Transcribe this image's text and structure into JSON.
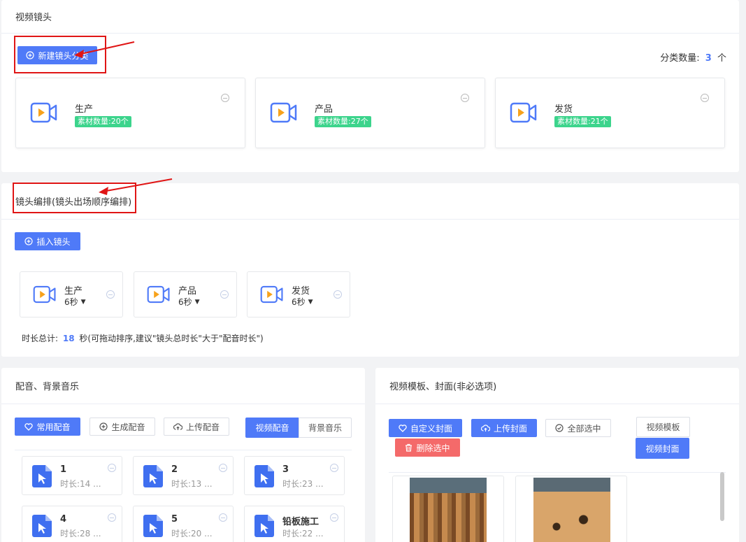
{
  "video_shots": {
    "title": "视频镜头",
    "new_category_button": "新建镜头分类",
    "category_count_label": "分类数量:",
    "category_count_value": "3",
    "category_count_unit": "个",
    "categories": [
      {
        "name": "生产",
        "badge": "素材数量:20个"
      },
      {
        "name": "产品",
        "badge": "素材数量:27个"
      },
      {
        "name": "发货",
        "badge": "素材数量:21个"
      }
    ]
  },
  "arrangement": {
    "title": "镜头编排(镜头出场顺序编排)",
    "insert_button": "插入镜头",
    "shots": [
      {
        "name": "生产",
        "duration": "6秒"
      },
      {
        "name": "产品",
        "duration": "6秒"
      },
      {
        "name": "发货",
        "duration": "6秒"
      }
    ],
    "total_label": "时长总计:",
    "total_value": "18",
    "total_suffix": "秒(可拖动排序,建议\"镜头总时长\"大于\"配音时长\")"
  },
  "audio": {
    "title": "配音、背景音乐",
    "common_button": "常用配音",
    "generate_button": "生成配音",
    "upload_button": "上传配音",
    "tab_voice": "视频配音",
    "tab_music": "背景音乐",
    "items": [
      {
        "title": "1",
        "duration": "时长:14 ..."
      },
      {
        "title": "2",
        "duration": "时长:13 ..."
      },
      {
        "title": "3",
        "duration": "时长:23 ..."
      },
      {
        "title": "4",
        "duration": "时长:28 ..."
      },
      {
        "title": "5",
        "duration": "时长:20 ..."
      },
      {
        "title": "铅板施工",
        "duration": "时长:22 ..."
      }
    ]
  },
  "template": {
    "title": "视频模板、封面(非必选项)",
    "custom_cover_button": "自定义封面",
    "upload_cover_button": "上传封面",
    "select_all_button": "全部选中",
    "delete_selected_button": "删除选中",
    "tab_template": "视频模板",
    "tab_cover": "视频封面"
  },
  "colors": {
    "primary": "#4f7af8",
    "badge_green": "#3cd48c",
    "danger": "#f46a6a",
    "annotation_red": "#e01515",
    "camera_orange": "#f7a21b"
  }
}
